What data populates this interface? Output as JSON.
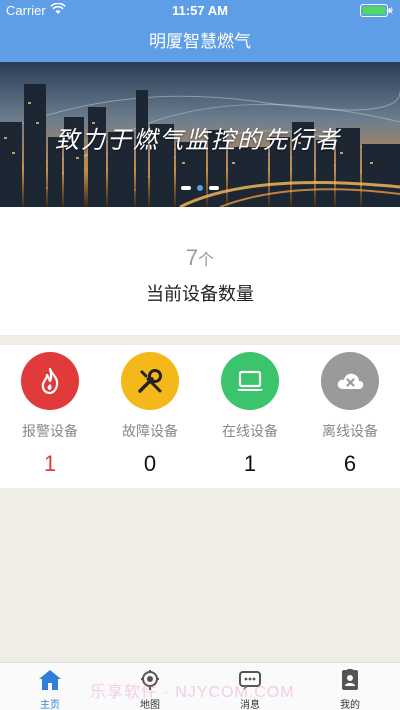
{
  "status": {
    "carrier": "Carrier",
    "time": "11:57 AM"
  },
  "navbar": {
    "title": "明厦智慧燃气"
  },
  "banner": {
    "slogan": "致力于燃气监控的先行者",
    "slide_count": 3,
    "active_slide": 2
  },
  "summary": {
    "count": "7",
    "unit": "个",
    "label": "当前设备数量"
  },
  "devices": [
    {
      "label": "报警设备",
      "count": "1",
      "color": "#e03a3a",
      "icon": "flame-icon"
    },
    {
      "label": "故障设备",
      "count": "0",
      "color": "#f5b81b",
      "icon": "wrench-icon"
    },
    {
      "label": "在线设备",
      "count": "1",
      "color": "#3cc46c",
      "icon": "laptop-icon"
    },
    {
      "label": "离线设备",
      "count": "6",
      "color": "#9a9a9a",
      "icon": "cloud-offline-icon"
    }
  ],
  "tabs": [
    {
      "label": "主页",
      "icon": "home-icon",
      "active": true
    },
    {
      "label": "地图",
      "icon": "map-pin-icon",
      "active": false
    },
    {
      "label": "消息",
      "icon": "message-icon",
      "active": false
    },
    {
      "label": "我的",
      "icon": "profile-icon",
      "active": false
    }
  ],
  "watermark": "乐享软件 · NJYCOM.COM",
  "colors": {
    "primary": "#5d9ee6",
    "active_tab": "#2f7fd8",
    "background": "#f0ece6"
  }
}
